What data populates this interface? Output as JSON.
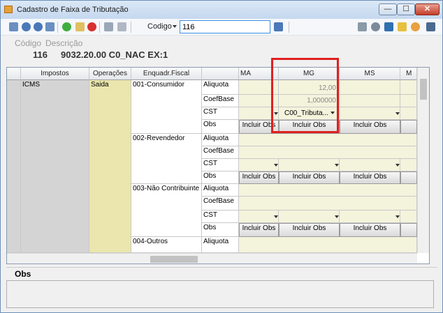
{
  "window": {
    "title": "Cadastro de Faixa de Tributação",
    "min": "—",
    "max": "☐",
    "close": "✕"
  },
  "toolbar": {
    "codigo_label": "Codigo",
    "codigo_value": "116"
  },
  "header": {
    "codigo_label": "Código",
    "descricao_label": "Descrição",
    "codigo_value": "116",
    "descricao_value": "9032.20.00 C0_NAC EX:1"
  },
  "grid": {
    "columns": [
      "Impostos",
      "Operações",
      "Enquadr.Fiscal",
      "",
      "MA",
      "MG",
      "MS",
      "M"
    ],
    "imposto": "ICMS",
    "operacao": "Saida",
    "groups": [
      {
        "enquadr": "001-Consumidor",
        "rows": [
          "Aliquota",
          "CoefBase",
          "CST",
          "Obs"
        ],
        "mg_aliquota": "12,00",
        "mg_coefbase": "1,000000",
        "mg_cst": "C00_Tributa..."
      },
      {
        "enquadr": "002-Revendedor",
        "rows": [
          "Aliquota",
          "CoefBase",
          "CST",
          "Obs"
        ]
      },
      {
        "enquadr": "003-Não Contribuinte",
        "rows": [
          "Aliquota",
          "CoefBase",
          "CST",
          "Obs"
        ]
      },
      {
        "enquadr": "004-Outros",
        "rows": [
          "Aliquota"
        ]
      }
    ],
    "incluir_obs": "Incluir Obs"
  },
  "obs": {
    "label": "Obs"
  }
}
